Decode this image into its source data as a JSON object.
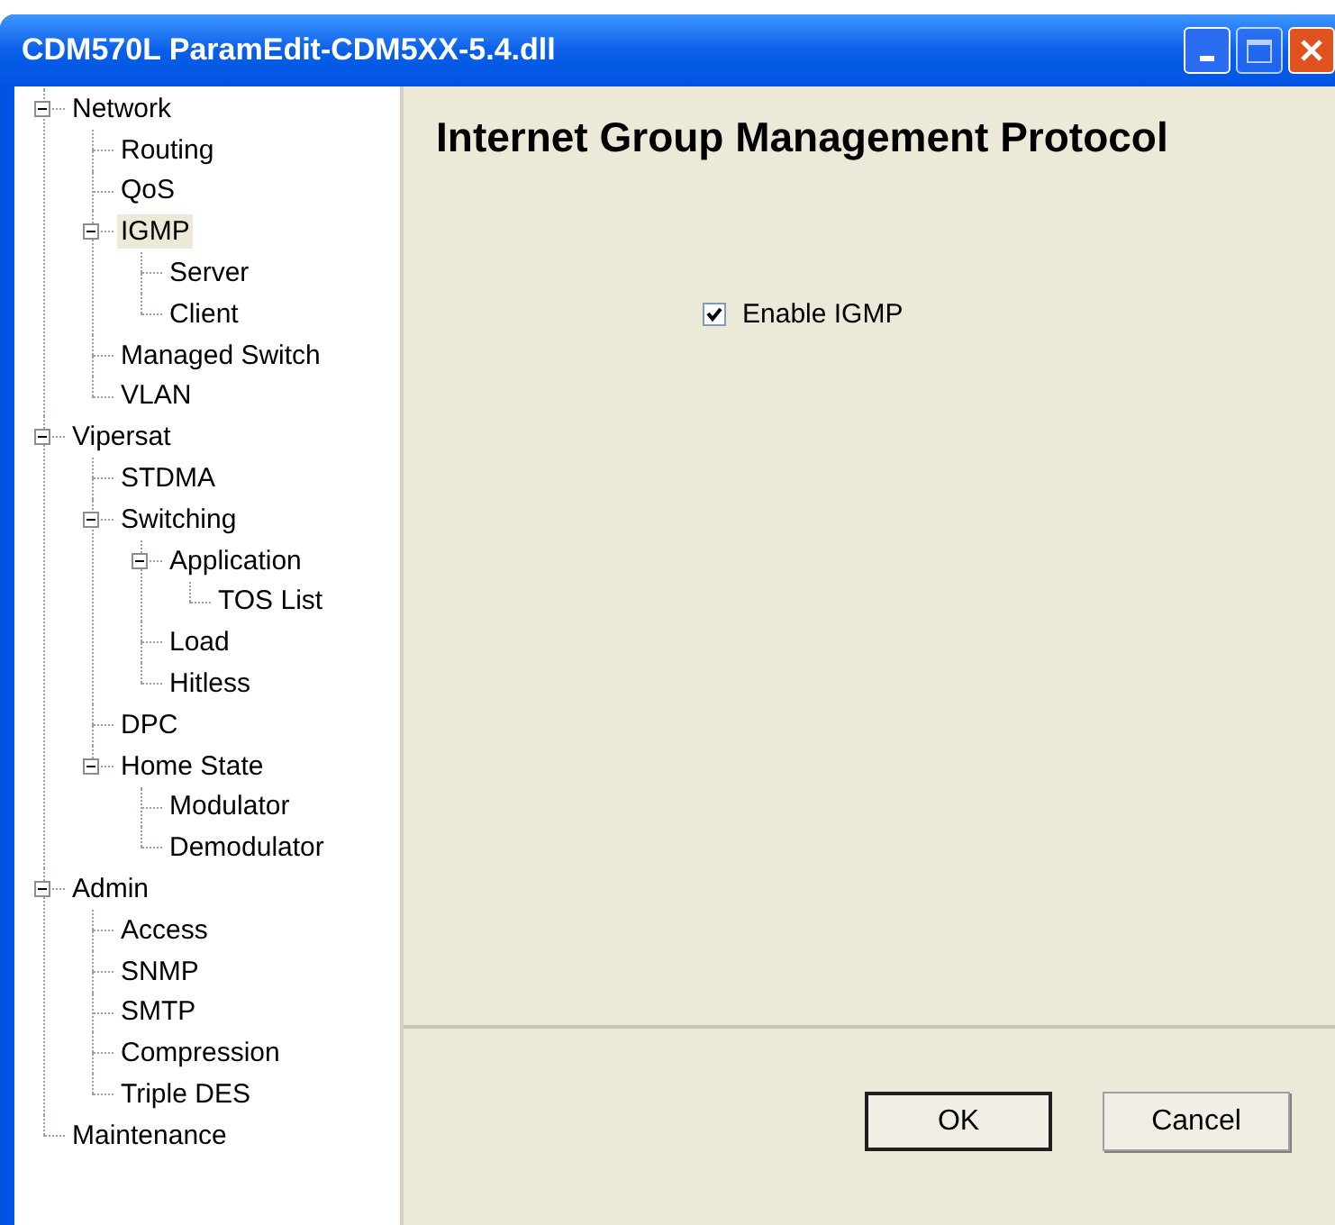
{
  "window": {
    "title": "CDM570L ParamEdit-CDM5XX-5.4.dll"
  },
  "tree": [
    {
      "label": "Network",
      "expanded": true,
      "selected": false,
      "children": [
        {
          "label": "Routing",
          "selected": false
        },
        {
          "label": "QoS",
          "selected": false
        },
        {
          "label": "IGMP",
          "expanded": true,
          "selected": true,
          "children": [
            {
              "label": "Server",
              "selected": false
            },
            {
              "label": "Client",
              "selected": false
            }
          ]
        },
        {
          "label": "Managed Switch",
          "selected": false
        },
        {
          "label": "VLAN",
          "selected": false
        }
      ]
    },
    {
      "label": "Vipersat",
      "expanded": true,
      "selected": false,
      "children": [
        {
          "label": "STDMA",
          "selected": false
        },
        {
          "label": "Switching",
          "expanded": true,
          "selected": false,
          "children": [
            {
              "label": "Application",
              "expanded": true,
              "selected": false,
              "children": [
                {
                  "label": "TOS List",
                  "selected": false
                }
              ]
            },
            {
              "label": "Load",
              "selected": false
            },
            {
              "label": "Hitless",
              "selected": false
            }
          ]
        },
        {
          "label": "DPC",
          "selected": false
        },
        {
          "label": "Home State",
          "expanded": true,
          "selected": false,
          "children": [
            {
              "label": "Modulator",
              "selected": false
            },
            {
              "label": "Demodulator",
              "selected": false
            }
          ]
        }
      ]
    },
    {
      "label": "Admin",
      "expanded": true,
      "selected": false,
      "children": [
        {
          "label": "Access",
          "selected": false
        },
        {
          "label": "SNMP",
          "selected": false
        },
        {
          "label": "SMTP",
          "selected": false
        },
        {
          "label": "Compression",
          "selected": false
        },
        {
          "label": "Triple DES",
          "selected": false
        }
      ]
    },
    {
      "label": "Maintenance",
      "selected": false
    }
  ],
  "panel": {
    "heading": "Internet Group Management Protocol",
    "checkbox": {
      "label": "Enable IGMP",
      "checked": true
    }
  },
  "buttons": [
    {
      "label": "OK",
      "default": true
    },
    {
      "label": "Cancel",
      "default": false
    }
  ]
}
